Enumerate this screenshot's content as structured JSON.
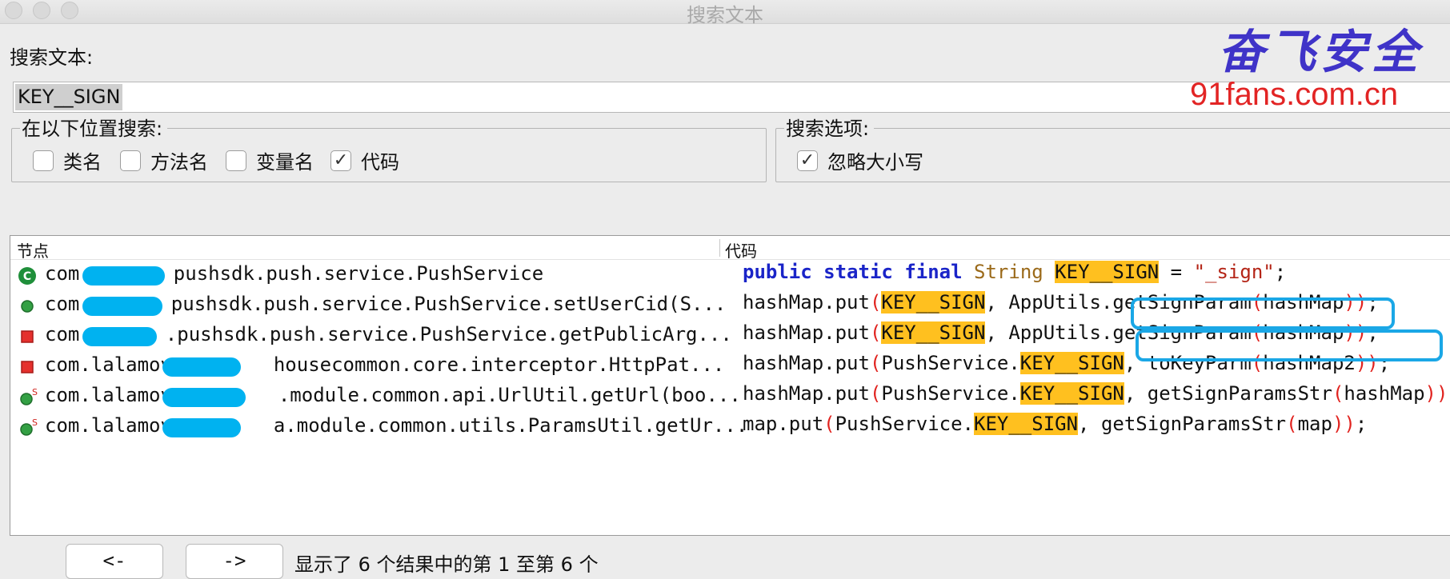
{
  "window": {
    "title": "搜索文本"
  },
  "search": {
    "label": "搜索文本:",
    "value": "KEY__SIGN"
  },
  "scope": {
    "legend": "在以下位置搜索:",
    "options": [
      {
        "label": "类名",
        "checked": false
      },
      {
        "label": "方法名",
        "checked": false
      },
      {
        "label": "变量名",
        "checked": false
      },
      {
        "label": "代码",
        "checked": true
      }
    ]
  },
  "options_group": {
    "legend": "搜索选项:",
    "options": [
      {
        "label": "忽略大小写",
        "checked": true
      }
    ]
  },
  "results": {
    "columns": [
      "节点",
      "代码"
    ],
    "rows": [
      {
        "icon": "class-icon",
        "node_prefix": "com.",
        "node_suffix": "pushsdk.push.service.PushService",
        "code": [
          {
            "t": "public",
            "c": "kw"
          },
          {
            "t": " "
          },
          {
            "t": "static",
            "c": "kw"
          },
          {
            "t": " "
          },
          {
            "t": "final",
            "c": "kw"
          },
          {
            "t": " "
          },
          {
            "t": "String",
            "c": "ty"
          },
          {
            "t": " "
          },
          {
            "t": "KEY__SIGN",
            "c": "hl"
          },
          {
            "t": " = "
          },
          {
            "t": "\"_sign\"",
            "c": "st"
          },
          {
            "t": ";"
          }
        ]
      },
      {
        "icon": "public-method-icon",
        "node_prefix": "com.",
        "node_suffix": "pushsdk.push.service.PushService.setUserCid(S...",
        "code": [
          {
            "t": "hashMap.put"
          },
          {
            "t": "(",
            "c": "pr"
          },
          {
            "t": "KEY__SIGN",
            "c": "hl"
          },
          {
            "t": ", AppUtils.getSignParam"
          },
          {
            "t": "(",
            "c": "pr"
          },
          {
            "t": "hashMap"
          },
          {
            "t": "))",
            "c": "pr"
          },
          {
            "t": ";"
          }
        ]
      },
      {
        "icon": "private-method-icon",
        "node_prefix": "com.",
        "node_suffix": ".pushsdk.push.service.PushService.getPublicArg...",
        "code": [
          {
            "t": "hashMap.put"
          },
          {
            "t": "(",
            "c": "pr"
          },
          {
            "t": "KEY__SIGN",
            "c": "hl"
          },
          {
            "t": ", AppUtils.getSignParam"
          },
          {
            "t": "(",
            "c": "pr"
          },
          {
            "t": "hashMap"
          },
          {
            "t": "))",
            "c": "pr"
          },
          {
            "t": ";"
          }
        ]
      },
      {
        "icon": "private-method-icon",
        "node_prefix": "com.lalamove.",
        "node_suffix": "housecommon.core.interceptor.HttpPat...",
        "code": [
          {
            "t": "hashMap.put"
          },
          {
            "t": "(",
            "c": "pr"
          },
          {
            "t": "PushService."
          },
          {
            "t": "KEY__SIGN",
            "c": "hl"
          },
          {
            "t": ", toKeyParm"
          },
          {
            "t": "(",
            "c": "pr"
          },
          {
            "t": "hashMap2"
          },
          {
            "t": "))",
            "c": "pr"
          },
          {
            "t": ";"
          }
        ]
      },
      {
        "icon": "static-method-icon",
        "node_prefix": "com.lalamove.",
        "node_suffix": ".module.common.api.UrlUtil.getUrl(boo...",
        "code": [
          {
            "t": "hashMap.put"
          },
          {
            "t": "(",
            "c": "pr"
          },
          {
            "t": "PushService."
          },
          {
            "t": "KEY__SIGN",
            "c": "hl"
          },
          {
            "t": ", getSignParamsStr"
          },
          {
            "t": "(",
            "c": "pr"
          },
          {
            "t": "hashMap"
          },
          {
            "t": "))",
            "c": "pr"
          },
          {
            "t": ";"
          }
        ]
      },
      {
        "icon": "static-method-icon",
        "node_prefix": "com.lalamove.",
        "node_suffix": "a.module.common.utils.ParamsUtil.getUr...",
        "code": [
          {
            "t": "map.put"
          },
          {
            "t": "(",
            "c": "pr"
          },
          {
            "t": "PushService."
          },
          {
            "t": "KEY__SIGN",
            "c": "hl"
          },
          {
            "t": ", getSignParamsStr"
          },
          {
            "t": "(",
            "c": "pr"
          },
          {
            "t": "map"
          },
          {
            "t": "))",
            "c": "pr"
          },
          {
            "t": ";"
          }
        ]
      }
    ]
  },
  "pager": {
    "prev": "<-",
    "next": "->",
    "status": "显示了 6 个结果中的第 1 至第 6 个"
  },
  "watermark": {
    "brand": "奋飞安全",
    "url": "91fans.com.cn"
  }
}
